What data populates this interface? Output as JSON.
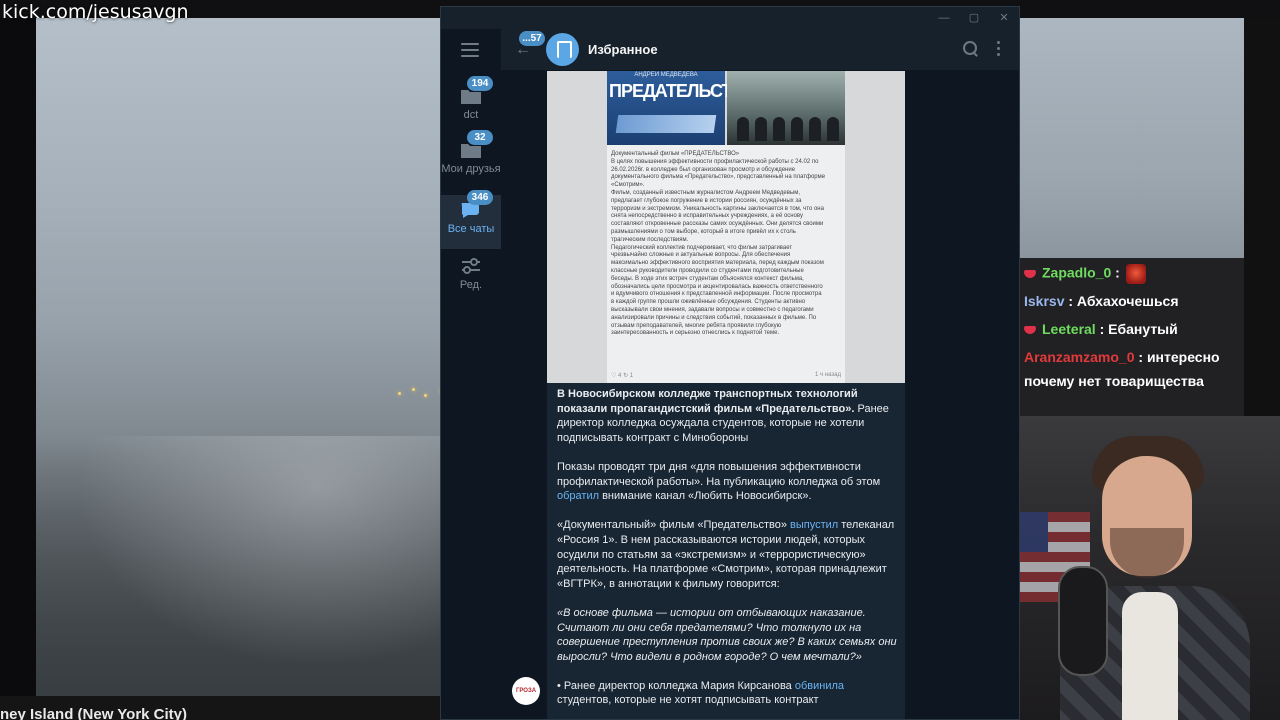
{
  "stream": {
    "url": "kick.com/jesusavgn",
    "camera_caption": "ney Island (New York City)"
  },
  "window": {
    "minimize": "—",
    "maximize": "▢",
    "close": "✕"
  },
  "sidebar": {
    "folders": [
      {
        "label": "dct",
        "count": "194"
      },
      {
        "label": "Мои друзья",
        "count": "32"
      },
      {
        "label": "Все чаты",
        "count": "346"
      },
      {
        "label": "Ред."
      }
    ]
  },
  "header": {
    "back_count": "...57",
    "title": "Избранное"
  },
  "post": {
    "image": {
      "author": "АНДРЕЙ МЕДВЕДЕВА",
      "cover_title": "ПРЕДАТЕЛЬСТВО",
      "doc_lines": [
        "Документальный фильм «ПРЕДАТЕЛЬСТВО»",
        "В целях повышения эффективности профилактической работы с 24.02 по",
        "26.02.2026г. в колледже был организован просмотр и обсуждение",
        "документального фильма «Предательство», представленный на платформе",
        "«Смотрим».",
        "Фильм, созданный известным журналистом Андреем Медведевым,",
        "предлагает глубокое погружение в истории россиян, осуждённых за",
        "терроризм и экстремизм. Уникальность картины заключается в том, что она",
        "снята непосредственно в исправительных учреждениях, а её основу",
        "составляют откровенные рассказы самих осуждённых. Они делятся своими",
        "размышлениями о том выборе, который в итоге привёл их к столь",
        "трагическим последствиям.",
        "Педагогический коллектив подчеркивает, что фильм затрагивает",
        "чрезвычайно сложные и актуальные вопросы. Для обеспечения",
        "максимально эффективного восприятия материала, перед каждым показом",
        "классные руководители проводили со студентами подготовительные",
        "беседы. В ходе этих встреч студентам объяснялся контекст фильма,",
        "обозначались цели просмотра и акцентировалась важность ответственного",
        "и вдумчивого отношения к представленной информации. После просмотра",
        "в каждой группе прошли оживлённые обсуждения. Студенты активно",
        "высказывали свои мнения, задавали вопросы и совместно с педагогами",
        "анализировали причины и следствия событий, показанных в фильме. По",
        "отзывам преподавателей, многие ребята проявили глубокую",
        "заинтересованность и серьезно отнеслись к поднятой теме."
      ],
      "likes": "♡ 4",
      "shares": "↻ 1",
      "time_ago": "1 ч назад"
    },
    "paragraphs": [
      {
        "bold": "В Новосибирском колледже транспортных технологий показали пропагандистский фильм «Предательство».",
        "text": " Ранее директор колледжа осуждала студентов, которые не хотели подписывать контракт с Минобороны"
      },
      {
        "before": "Показы проводят три дня «для повышения эффективности профилактической работы». На публикацию колледжа об этом ",
        "link": "обратил",
        "after": " внимание канал «Любить Новосибирск»."
      },
      {
        "before": "«Документальный» фильм  «Предательство» ",
        "link": "выпустил",
        "after": " телеканал «Россия 1». В нем рассказываются истории людей, которых осудили по статьям за «экстремизм» и «террористическую» деятельность. На платформе «Смотрим», которая принадлежит «ВГТРК», в аннотации к фильму говорится:"
      },
      {
        "quote": "«В основе фильма — истории от отбывающих наказание. Считают ли они себя предателями? Что толкнуло их на совершение преступления против своих же? В каких семьях они выросли? Что видели в родном городе? О чем мечтали?»"
      },
      {
        "before": "• Ранее директор колледжа Мария Кирсанова ",
        "link": "обвинила",
        "after": " студентов, которые не хотят подписывать контракт"
      }
    ],
    "channel_avatar": "ГРОЗА"
  },
  "chat": {
    "messages": [
      {
        "user": "Zapadlo_0",
        "text": ":"
      },
      {
        "user": "Iskrsv",
        "text": ": Абхахочешься"
      },
      {
        "user": "Leeteral",
        "text": ": Ебанутый"
      },
      {
        "user": "Aranzamzamo_0",
        "text": ": интересно"
      },
      {
        "text": "почему нет товарищества"
      }
    ]
  },
  "colors": {
    "telegram_bg": "#17212b",
    "messages_bg": "#0e1621",
    "bubble": "#182533",
    "link": "#6ab3f3",
    "badge": "#4a8ec6"
  }
}
